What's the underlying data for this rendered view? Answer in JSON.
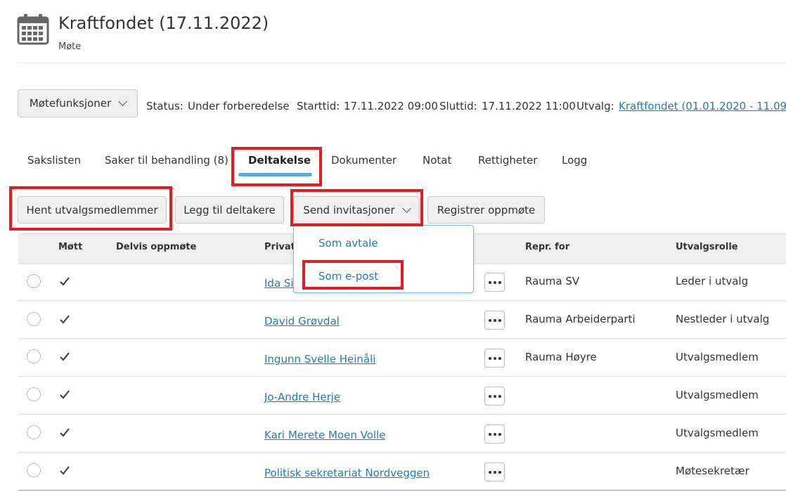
{
  "header": {
    "title": "Kraftfondet (17.11.2022)",
    "subtitle": "Møte",
    "icon": "calendar-icon"
  },
  "toolbar": {
    "functions_label": "Møtefunksjoner"
  },
  "meta": {
    "status_label": "Status:",
    "status_value": "Under forberedelse",
    "start_label": "Starttid:",
    "start_value": "17.11.2022 09:00",
    "end_label": "Sluttid:",
    "end_value": "17.11.2022 11:00",
    "committee_label": "Utvalg:",
    "committee_link": "Kraftfondet (01.01.2020 - 11.09.2"
  },
  "tabs": [
    {
      "label": "Sakslisten"
    },
    {
      "label": "Saker til behandling (8)"
    },
    {
      "label": "Deltakelse",
      "active": true
    },
    {
      "label": "Dokumenter"
    },
    {
      "label": "Notat"
    },
    {
      "label": "Rettigheter"
    },
    {
      "label": "Logg"
    }
  ],
  "actions": {
    "fetch_members": "Hent utvalgsmedlemmer",
    "add_participants": "Legg til deltakere",
    "send_invitations": "Send invitasjoner",
    "register_attendance": "Registrer oppmøte"
  },
  "dropdown": {
    "items": [
      "Som avtale",
      "Som e-post"
    ]
  },
  "table": {
    "columns": [
      "Møtt",
      "Delvis oppmøte",
      "Privat",
      "Repr. for",
      "Utvalgsrolle"
    ],
    "rows": [
      {
        "name": "Ida Si",
        "repr": "Rauma SV",
        "role": "Leder i utvalg",
        "attended": true
      },
      {
        "name": "David Grøvdal",
        "repr": "Rauma Arbeiderparti",
        "role": "Nestleder i utvalg",
        "attended": true
      },
      {
        "name": "Ingunn Svelle Heinåli",
        "repr": "Rauma Høyre",
        "role": "Utvalgsmedlem",
        "attended": true
      },
      {
        "name": "Jo-Andre Herje",
        "repr": "",
        "role": "Utvalgsmedlem",
        "attended": true
      },
      {
        "name": "Kari Merete Moen Volle",
        "repr": "",
        "role": "Utvalgsmedlem",
        "attended": true
      },
      {
        "name": "Politisk sekretariat Nordveggen",
        "repr": "",
        "role": "Møtesekretær",
        "attended": true
      }
    ]
  },
  "colors": {
    "link": "#1f7bbf",
    "highlight": "#e11c24",
    "tab_underline": "#5aa9d6"
  }
}
